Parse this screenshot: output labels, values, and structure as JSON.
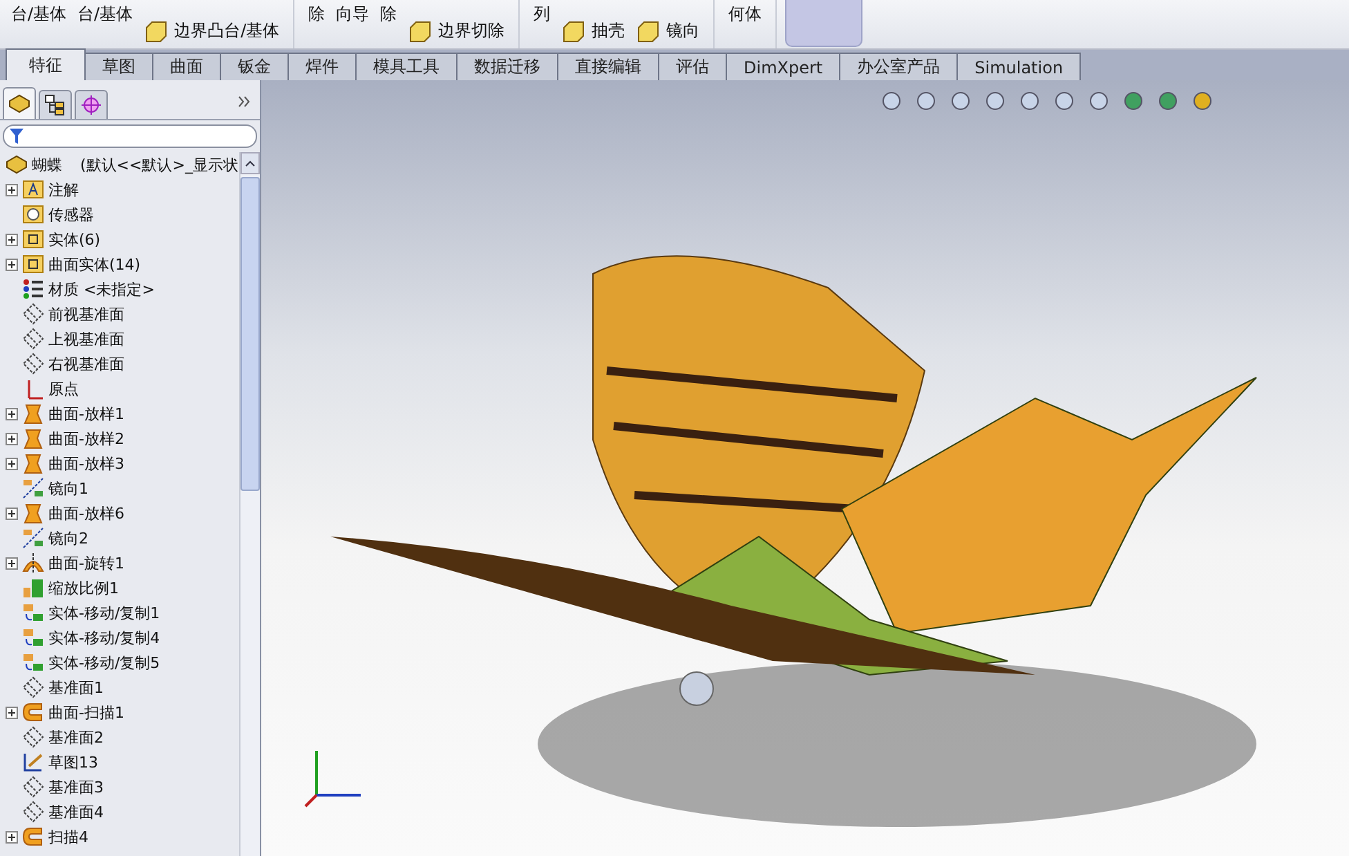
{
  "toolbar": {
    "groups": [
      {
        "items": [
          {
            "label": "台/基体",
            "kind": "big"
          },
          {
            "label": "台/基体",
            "kind": "big"
          },
          {
            "label": "边界凸台/基体",
            "kind": "small"
          }
        ]
      },
      {
        "items": [
          {
            "label": "除",
            "kind": "big"
          },
          {
            "label": "向导",
            "kind": "big"
          },
          {
            "label": "除",
            "kind": "big"
          },
          {
            "label": "边界切除",
            "kind": "small"
          }
        ]
      },
      {
        "items": [
          {
            "label": "列",
            "kind": "big"
          },
          {
            "label": "抽壳",
            "kind": "small"
          },
          {
            "label": "镜向",
            "kind": "small"
          }
        ]
      },
      {
        "items": [
          {
            "label": "何体",
            "kind": "big"
          }
        ]
      }
    ]
  },
  "tabs": [
    {
      "label": "特征",
      "selected": true
    },
    {
      "label": "草图",
      "selected": false
    },
    {
      "label": "曲面",
      "selected": false
    },
    {
      "label": "钣金",
      "selected": false
    },
    {
      "label": "焊件",
      "selected": false
    },
    {
      "label": "模具工具",
      "selected": false
    },
    {
      "label": "数据迁移",
      "selected": false
    },
    {
      "label": "直接编辑",
      "selected": false
    },
    {
      "label": "评估",
      "selected": false
    },
    {
      "label": "DimXpert",
      "selected": false
    },
    {
      "label": "办公室产品",
      "selected": false
    },
    {
      "label": "Simulation",
      "selected": false
    }
  ],
  "panel_tabs": [
    {
      "kind": "feature",
      "selected": true
    },
    {
      "kind": "property",
      "selected": false
    },
    {
      "kind": "config",
      "selected": false
    }
  ],
  "tree": {
    "root": {
      "name": "蝴蝶",
      "config": "(默认<<默认>_显示状"
    },
    "items": [
      {
        "label": "注解",
        "kind": "annotation",
        "expandable": true
      },
      {
        "label": "传感器",
        "kind": "sensor",
        "expandable": false
      },
      {
        "label": "实体(6)",
        "kind": "folder",
        "expandable": true
      },
      {
        "label": "曲面实体(14)",
        "kind": "folder",
        "expandable": true
      },
      {
        "label": "材质 <未指定>",
        "kind": "material",
        "expandable": false
      },
      {
        "label": "前视基准面",
        "kind": "plane",
        "expandable": false
      },
      {
        "label": "上视基准面",
        "kind": "plane",
        "expandable": false
      },
      {
        "label": "右视基准面",
        "kind": "plane",
        "expandable": false
      },
      {
        "label": "原点",
        "kind": "origin",
        "expandable": false
      },
      {
        "label": "曲面-放样1",
        "kind": "loft",
        "expandable": true
      },
      {
        "label": "曲面-放样2",
        "kind": "loft",
        "expandable": true
      },
      {
        "label": "曲面-放样3",
        "kind": "loft",
        "expandable": true
      },
      {
        "label": "镜向1",
        "kind": "mirror",
        "expandable": false
      },
      {
        "label": "曲面-放样6",
        "kind": "loft",
        "expandable": true
      },
      {
        "label": "镜向2",
        "kind": "mirror",
        "expandable": false
      },
      {
        "label": "曲面-旋转1",
        "kind": "revolve",
        "expandable": true
      },
      {
        "label": "缩放比例1",
        "kind": "scale",
        "expandable": false
      },
      {
        "label": "实体-移动/复制1",
        "kind": "move",
        "expandable": false
      },
      {
        "label": "实体-移动/复制4",
        "kind": "move",
        "expandable": false
      },
      {
        "label": "实体-移动/复制5",
        "kind": "move",
        "expandable": false
      },
      {
        "label": "基准面1",
        "kind": "plane",
        "expandable": false
      },
      {
        "label": "曲面-扫描1",
        "kind": "sweep",
        "expandable": true
      },
      {
        "label": "基准面2",
        "kind": "plane",
        "expandable": false
      },
      {
        "label": "草图13",
        "kind": "sketch",
        "expandable": false
      },
      {
        "label": "基准面3",
        "kind": "plane",
        "expandable": false
      },
      {
        "label": "基准面4",
        "kind": "plane",
        "expandable": false
      },
      {
        "label": "扫描4",
        "kind": "sweep",
        "expandable": true
      }
    ]
  }
}
